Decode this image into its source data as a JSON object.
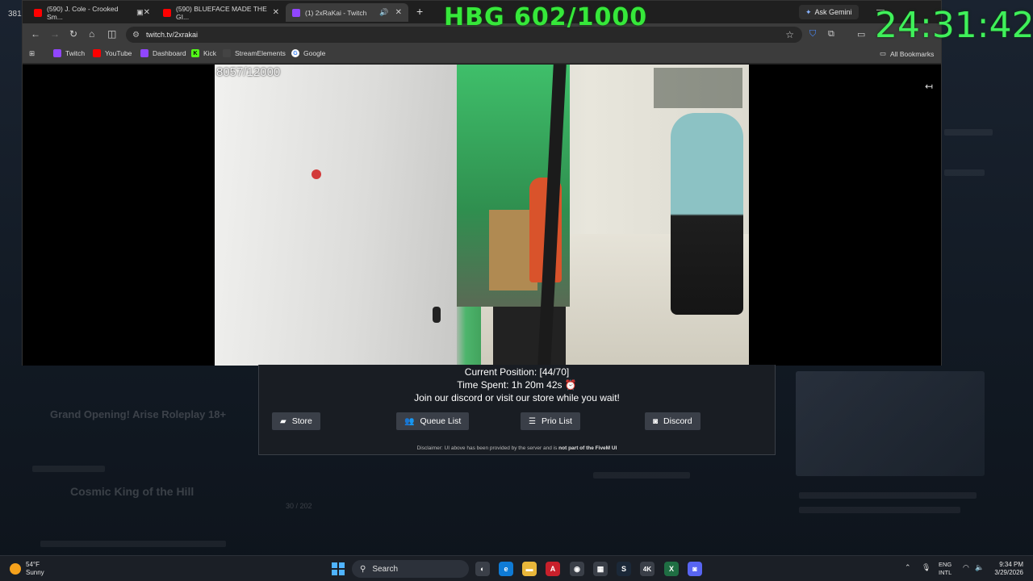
{
  "corner_label": "381",
  "overlay": {
    "hbg": "HBG 602/1000",
    "timer": "24:31:42",
    "video_counter": "8057/12000"
  },
  "browser": {
    "tabs": [
      {
        "label": "(590) J. Cole - Crooked Sm...",
        "icon": "youtube-icon",
        "color": "#ff0000"
      },
      {
        "label": "(590) BLUEFACE MADE THE GI...",
        "icon": "youtube-icon",
        "color": "#ff0000"
      },
      {
        "label": "(1) 2xRaKai - Twitch",
        "icon": "twitch-icon",
        "color": "#9146ff"
      }
    ],
    "ask_gemini": "Ask Gemini",
    "url": "twitch.tv/2xrakai",
    "bookmarks": [
      {
        "label": "Twitch",
        "color": "#9146ff"
      },
      {
        "label": "YouTube",
        "color": "#ff0000"
      },
      {
        "label": "Dashboard",
        "color": "#9146ff"
      },
      {
        "label": "Kick",
        "color": "#53fc18"
      },
      {
        "label": "StreamElements",
        "color": "#222222"
      },
      {
        "label": "Google",
        "color": "#4285f4"
      }
    ],
    "all_bookmarks": "All Bookmarks"
  },
  "queue": {
    "position": "Current Position: [44/70]",
    "time_spent": "Time Spent: 1h 20m 42s ⏰",
    "join_msg": "Join our discord or visit our store while you wait!",
    "buttons": {
      "store": "Store",
      "queue_list": "Queue List",
      "prio_list": "Prio List",
      "discord": "Discord"
    },
    "disclaimer_prefix": "Disclaimer: UI above has been provided by the server and is ",
    "disclaimer_bold": "not part of the FiveM UI"
  },
  "background": {
    "server_name": "Grand Opening! Arise Roleplay 18+",
    "featured_title": "Cosmic King of the Hill",
    "count": "30 / 202"
  },
  "taskbar": {
    "weather_temp": "54°F",
    "weather_desc": "Sunny",
    "search_label": "Search",
    "lang_top": "ENG",
    "lang_bottom": "INTL",
    "time": "9:34 PM",
    "date": "3/29/2026"
  },
  "colors": {
    "accent_green": "#36e83a",
    "panel_bg": "#191d23",
    "button_bg": "#3a3f48"
  }
}
